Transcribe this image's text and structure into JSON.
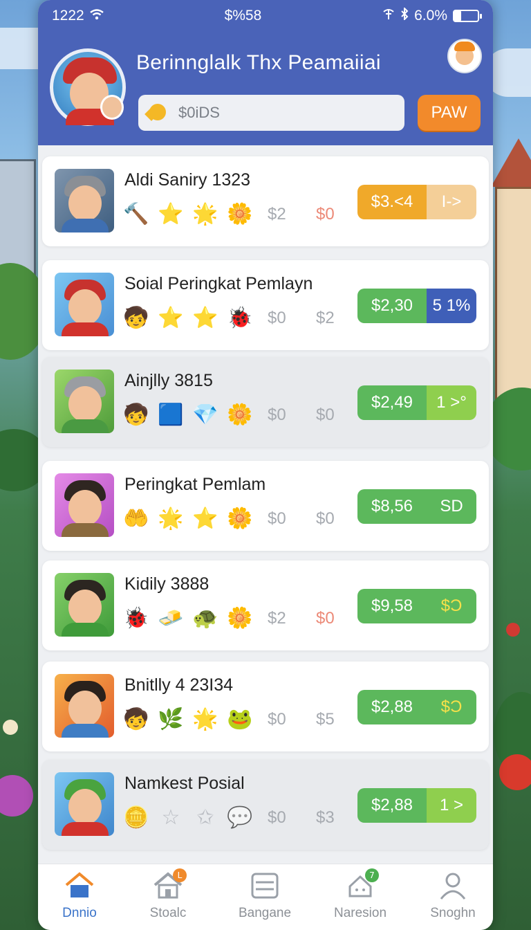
{
  "status_bar": {
    "time": "1222",
    "center": "$%58",
    "battery": "6.0%",
    "battery_level": 0.3
  },
  "header": {
    "title": "Berinnglalk Thx Peamaiiai",
    "search_placeholder": "$0iDS",
    "paw_label": "PAW"
  },
  "players": [
    {
      "name": "Aldi Saniry 1323",
      "stat1": "$2",
      "stat2": "$0",
      "stat2_red": true,
      "price": "$3.<4",
      "tag": "I->",
      "price_color": "#f0a92a",
      "tag_color": "#f4cf98",
      "badges": [
        "🔨",
        "⭐",
        "🌟",
        "🌼"
      ],
      "alt": false
    },
    {
      "name": "Soial Peringkat Pemlayn",
      "stat1": "$0",
      "stat2": "$2",
      "stat2_red": false,
      "price": "$2,30",
      "tag": "5 1%",
      "price_color": "#5cb85c",
      "tag_color": "#3f5fb8",
      "badges": [
        "🧒",
        "⭐",
        "⭐",
        "🐞"
      ],
      "alt": false
    },
    {
      "name": "Ainjlly 3815",
      "stat1": "$0",
      "stat2": "$0",
      "stat2_red": false,
      "price": "$2,49",
      "tag": "1 >°",
      "price_color": "#5cb85c",
      "tag_color": "#8fcf4e",
      "badges": [
        "🧒",
        "🟦",
        "💎",
        "🌼"
      ],
      "alt": true
    },
    {
      "name": "Peringkat Pemlam",
      "stat1": "$0",
      "stat2": "$0",
      "stat2_red": false,
      "price": "$8,56",
      "tag": "SD",
      "price_color": "#5cb85c",
      "tag_color": "#5cb85c",
      "badges": [
        "🤲",
        "🌟",
        "⭐",
        "🌼"
      ],
      "alt": false
    },
    {
      "name": "Kidily 3888",
      "stat1": "$2",
      "stat2": "$0",
      "stat2_red": true,
      "price": "$9,58",
      "tag": "$Ͻ",
      "price_color": "#5cb85c",
      "tag_color": "#5cb85c",
      "badges": [
        "🐞",
        "🧈",
        "🐢",
        "🌼"
      ],
      "alt": false
    },
    {
      "name": "Bnitlly 4 23I34",
      "stat1": "$0",
      "stat2": "$5",
      "stat2_red": false,
      "price": "$2,88",
      "tag": "$Ͻ",
      "price_color": "#5cb85c",
      "tag_color": "#5cb85c",
      "badges": [
        "🧒",
        "🌿",
        "🌟",
        "🐸"
      ],
      "alt": false
    },
    {
      "name": "Namkest Posial",
      "stat1": "$0",
      "stat2": "$3",
      "stat2_red": false,
      "price": "$2,88",
      "tag": "1 >",
      "price_color": "#5cb85c",
      "tag_color": "#8fcf4e",
      "badges": [
        "🪙",
        "☆",
        "✩",
        "💬"
      ],
      "alt": true
    }
  ],
  "tabs": [
    {
      "label": "Dnnio",
      "icon": "home-icon",
      "active": true,
      "badge": ""
    },
    {
      "label": "Stoalc",
      "icon": "store-icon",
      "active": false,
      "badge": "L"
    },
    {
      "label": "Bangane",
      "icon": "list-icon",
      "active": false,
      "badge": ""
    },
    {
      "label": "Naresion",
      "icon": "cloud-icon",
      "active": false,
      "badge": "7"
    },
    {
      "label": "Snoghn",
      "icon": "profile-icon",
      "active": false,
      "badge": ""
    }
  ],
  "colors": {
    "header": "#4a63b8",
    "accent_orange": "#f28a2b",
    "active_tab": "#3a73c9"
  }
}
